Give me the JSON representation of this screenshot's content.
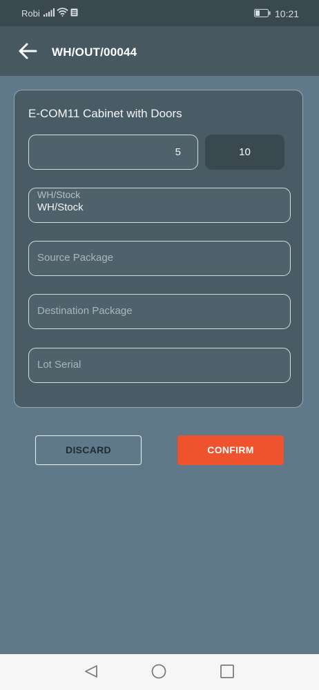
{
  "status_bar": {
    "carrier": "Robi",
    "time": "10:21"
  },
  "app_bar": {
    "title": "WH/OUT/00044"
  },
  "form": {
    "product_name": "E-COM11 Cabinet with Doors",
    "quantity_done": "5",
    "quantity_total": "10",
    "location_label": "WH/Stock",
    "location_value": "WH/Stock",
    "source_package_placeholder": "Source Package",
    "destination_package_placeholder": "Destination Package",
    "lot_serial_placeholder": "Lot Serial"
  },
  "actions": {
    "discard_label": "DISCARD",
    "confirm_label": "CONFIRM"
  },
  "colors": {
    "accent": "#ef532d",
    "background": "#60798a",
    "app_bar": "#475861",
    "card": "#495b64"
  },
  "icons": {
    "back": "arrow-left-icon",
    "nav_back": "triangle-back-icon",
    "nav_home": "circle-home-icon",
    "nav_recents": "square-recents-icon"
  }
}
